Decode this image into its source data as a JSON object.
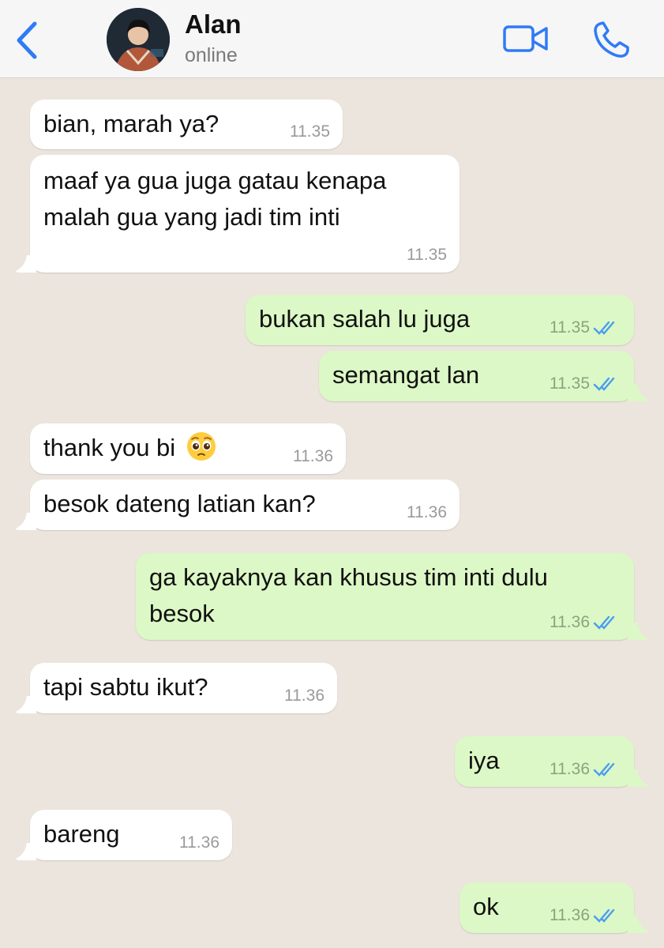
{
  "header": {
    "contact_name": "Alan",
    "contact_status": "online",
    "accent_color": "#2f7bf6"
  },
  "icons": {
    "back": "chevron-left-icon",
    "video": "video-camera-icon",
    "phone": "phone-icon",
    "read_receipt": "double-check-icon",
    "emoji": "pleading-face-emoji"
  },
  "messages": [
    {
      "direction": "in",
      "text": "bian, marah ya?",
      "time": "11.35"
    },
    {
      "direction": "in",
      "text_lines": [
        "maaf ya gua juga gatau kenapa",
        "malah gua yang jadi tim inti"
      ],
      "time": "11.35"
    },
    {
      "direction": "out",
      "text": "bukan salah lu juga",
      "time": "11.35",
      "read": true
    },
    {
      "direction": "out",
      "text": "semangat lan",
      "time": "11.35",
      "read": true
    },
    {
      "direction": "in",
      "text": "thank you bi",
      "emoji": "🥺",
      "time": "11.36"
    },
    {
      "direction": "in",
      "text": "besok dateng latian kan?",
      "time": "11.36"
    },
    {
      "direction": "out",
      "text_lines": [
        "ga kayaknya kan khusus tim inti dulu",
        "besok"
      ],
      "time": "11.36",
      "read": true
    },
    {
      "direction": "in",
      "text": "tapi sabtu ikut?",
      "time": "11.36"
    },
    {
      "direction": "out",
      "text": "iya",
      "time": "11.36",
      "read": true
    },
    {
      "direction": "in",
      "text": "bareng",
      "time": "11.36"
    },
    {
      "direction": "out",
      "text": "ok",
      "time": "11.36",
      "read": true
    }
  ]
}
